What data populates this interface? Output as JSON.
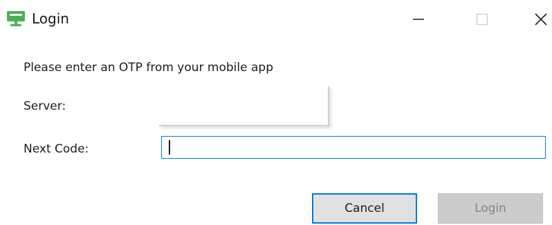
{
  "window": {
    "title": "Login",
    "icon": "monitor-icon",
    "controls": {
      "minimize_icon": "minimize-icon",
      "maximize_icon": "maximize-icon",
      "close_icon": "close-icon"
    }
  },
  "form": {
    "prompt": "Please enter an OTP from your mobile app",
    "server_label": "Server:",
    "server_value": "",
    "next_code_label": "Next Code:",
    "next_code_value": ""
  },
  "buttons": {
    "cancel_label": "Cancel",
    "login_label": "Login",
    "login_enabled": false
  },
  "colors": {
    "accent": "#0078d7",
    "icon_green": "#4caf50",
    "disabled_text": "#838383"
  }
}
